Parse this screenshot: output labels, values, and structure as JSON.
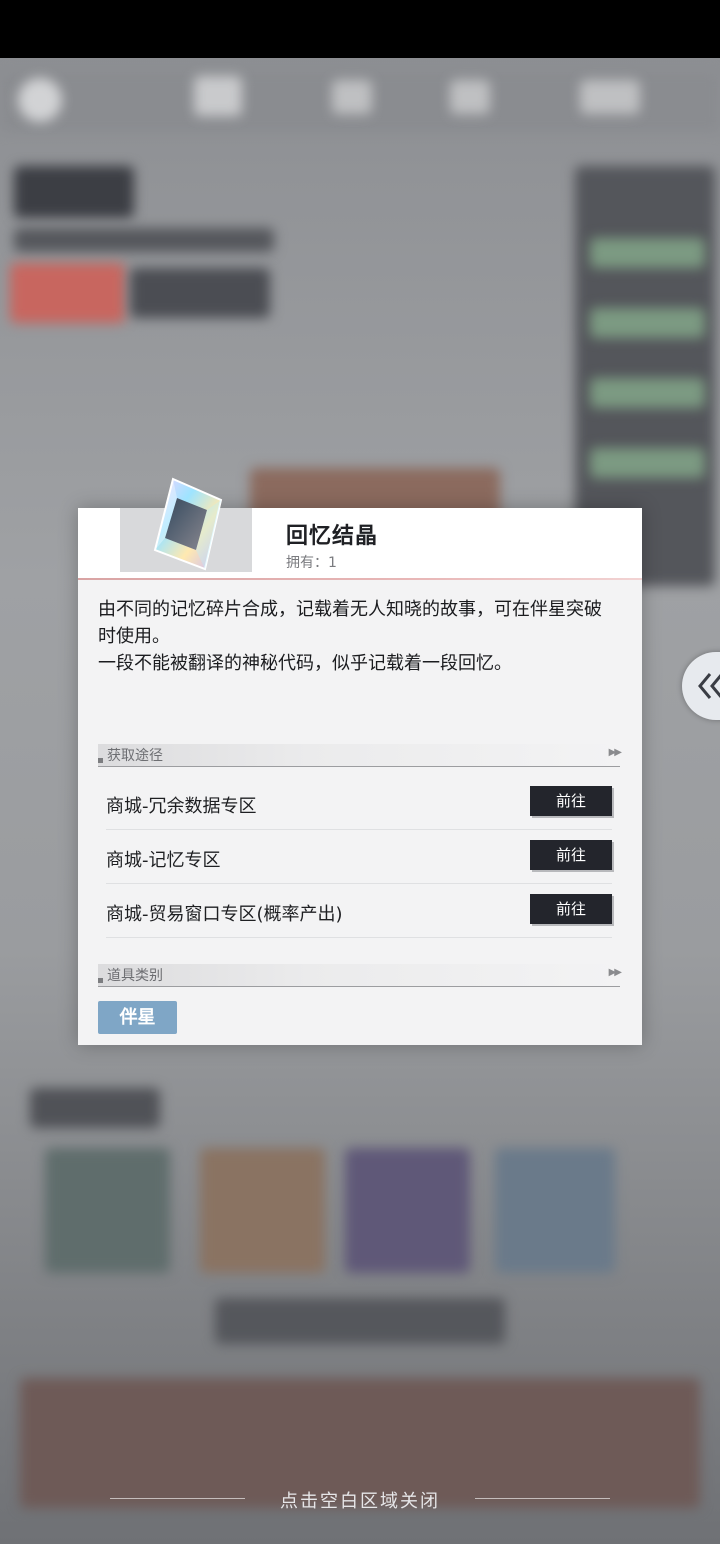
{
  "item": {
    "name": "回忆结晶",
    "owned": "拥有：1",
    "description": "由不同的记忆碎片合成，记载着无人知晓的故事，可在伴星突破时使用。\n一段不能被翻译的神秘代码，似乎记载着一段回忆。"
  },
  "sources": {
    "title": "获取途径",
    "rows": [
      {
        "label": "商城-冗余数据专区",
        "button": "前往"
      },
      {
        "label": "商城-记忆专区",
        "button": "前往"
      },
      {
        "label": "商城-贸易窗口专区(概率产出)",
        "button": "前往"
      }
    ]
  },
  "category": {
    "title": "道具类别",
    "chip": "伴星"
  },
  "footer": {
    "close_hint": "点击空白区域关闭"
  },
  "colors": {
    "accent_line": "#e8b7b7",
    "goto_button": "#23252c",
    "category_chip": "#7fa6c6"
  }
}
